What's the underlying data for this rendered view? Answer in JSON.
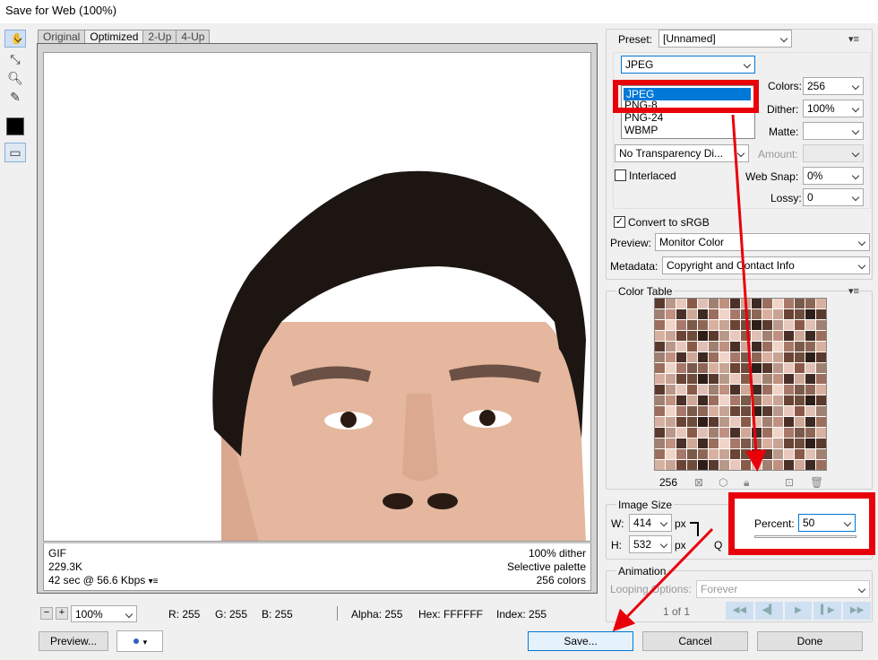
{
  "window": {
    "title": "Save for Web (100%)"
  },
  "tabs": [
    "Original",
    "Optimized",
    "2-Up",
    "4-Up"
  ],
  "info": {
    "format": "GIF",
    "size": "229.3K",
    "time": "42 sec @ 56.6 Kbps",
    "dither": "100% dither",
    "palette": "Selective palette",
    "colors": "256 colors"
  },
  "status": {
    "zoom": "100%",
    "r": "R: 255",
    "g": "G: 255",
    "b": "B: 255",
    "alpha": "Alpha: 255",
    "hex": "Hex: FFFFFF",
    "index": "Index: 255"
  },
  "buttons": {
    "preview": "Preview...",
    "save": "Save...",
    "cancel": "Cancel",
    "done": "Done"
  },
  "settings": {
    "preset_label": "Preset:",
    "preset_value": "[Unnamed]",
    "format_value": "JPEG",
    "format_options": [
      "JPEG",
      "PNG-8",
      "PNG-24",
      "WBMP"
    ],
    "colors_label": "Colors:",
    "colors_value": "256",
    "dither_label": "Dither:",
    "dither_value": "100%",
    "matte_label": "Matte:",
    "transparency_value": "No Transparency Di...",
    "amount_label": "Amount:",
    "interlaced_label": "Interlaced",
    "websnap_label": "Web Snap:",
    "websnap_value": "0%",
    "lossy_label": "Lossy:",
    "lossy_value": "0",
    "convert_label": "Convert to sRGB",
    "preview_label": "Preview:",
    "preview_value": "Monitor Color",
    "metadata_label": "Metadata:",
    "metadata_value": "Copyright and Contact Info"
  },
  "color_table": {
    "title": "Color Table",
    "count": "256"
  },
  "image_size": {
    "title": "Image Size",
    "w_label": "W:",
    "w_value": "414",
    "h_label": "H:",
    "h_value": "532",
    "unit": "px",
    "percent_label": "Percent:",
    "percent_value": "50",
    "q_label": "Q"
  },
  "animation": {
    "title": "Animation",
    "looping_label": "Looping Options:",
    "looping_value": "Forever",
    "frame_counter": "1 of 1"
  },
  "palette_colors": [
    "#5a3a2e",
    "#8a5a48",
    "#c09080",
    "#3d2a22",
    "#a8786a",
    "#d8b0a0",
    "#6e4c3c",
    "#b89888",
    "#e0c0b4",
    "#4a3028",
    "#9c6e5e",
    "#7a5a4a",
    "#c8a494",
    "#2e1e18",
    "#e8c8bc",
    "#a08070",
    "#d0a898",
    "#f0d4c8",
    "#8e6656",
    "#6a4434"
  ]
}
